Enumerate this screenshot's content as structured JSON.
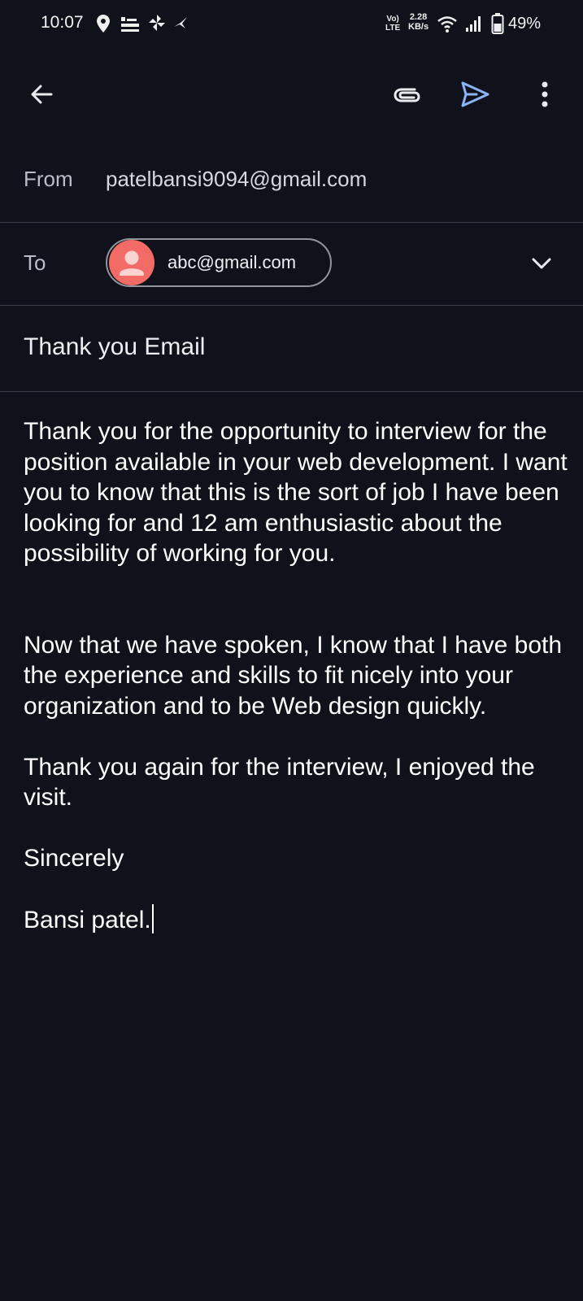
{
  "status_bar": {
    "time": "10:07",
    "network_top": "Vo)",
    "network_bottom": "LTE",
    "speed_top": "2.28",
    "speed_bottom": "KB/s",
    "battery": "49%",
    "left_icons": [
      "location-pin-icon",
      "notification-app-icon",
      "pinwheel-icon",
      "bird-app-icon"
    ],
    "right_icons": [
      "wifi-icon",
      "signal-icon",
      "battery-icon"
    ]
  },
  "app_bar": {
    "icons": [
      "back-arrow-icon",
      "attach-icon",
      "send-icon",
      "more-vert-icon"
    ],
    "send_color": "#8ab4f8"
  },
  "compose": {
    "from_label": "From",
    "from_value": "patelbansi9094@gmail.com",
    "to_label": "To",
    "to_chip": "abc@gmail.com",
    "avatar_color": "#f26b67",
    "subject": "Thank you Email",
    "body": {
      "p1": "Thank you for the opportunity to interview for the position available in your web development. I want you to know that this is the sort of job I have been looking for and 12 am enthusiastic about the possibility of working for you.",
      "p2": "Now that we have spoken, I know that I have both the experience and skills to fit nicely into your organization and to be Web design quickly.",
      "p3": "Thank you again for the interview, I enjoyed the visit.",
      "p4": "Sincerely",
      "p5": "Bansi patel."
    }
  }
}
